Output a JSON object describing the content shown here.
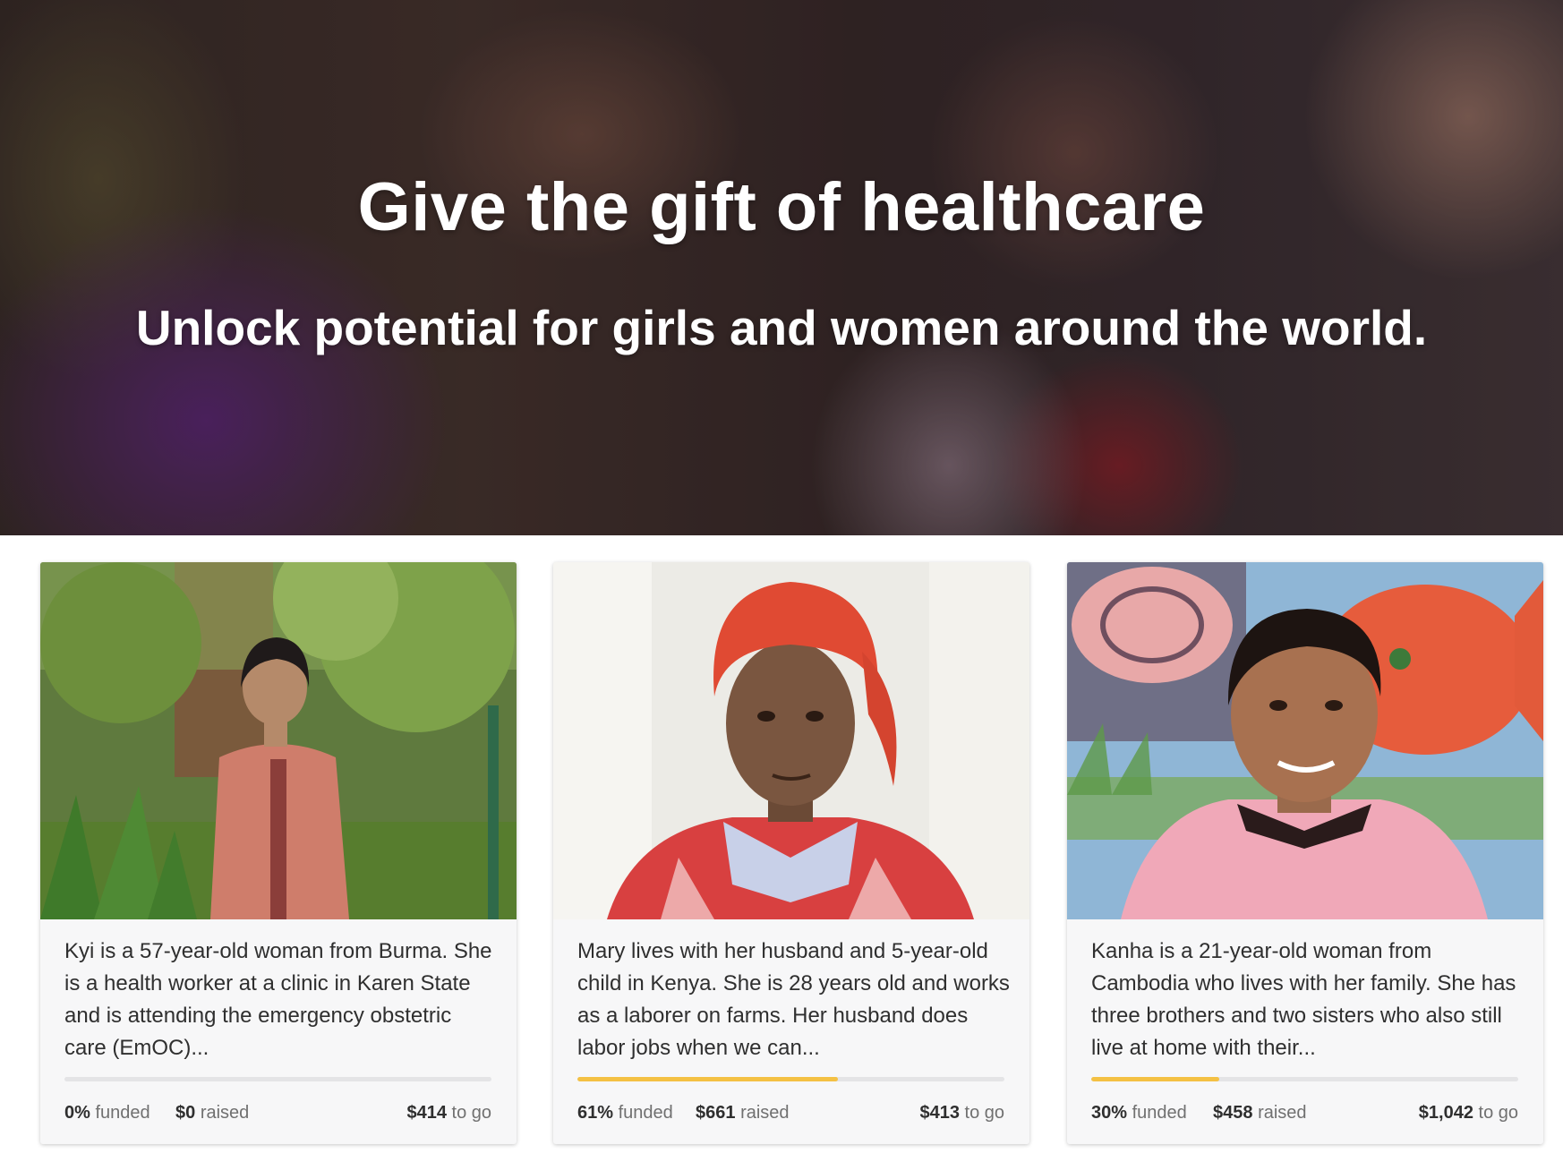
{
  "hero": {
    "title": "Give the gift of healthcare",
    "subtitle": "Unlock potential for girls and women around the world."
  },
  "colors": {
    "progress_fill": "#f4c144",
    "progress_track": "#e4e4e6",
    "card_background": "#f7f7f8"
  },
  "cards": [
    {
      "photo": "portrait of Kyi standing in a garden",
      "description": "Kyi is a 57-year-old woman from Burma. She is a health worker at a clinic in Karen State and is attending the emergency obstetric care (EmOC)...",
      "progress_percent": 0,
      "funded_value": "0%",
      "funded_label": "funded",
      "raised_value": "$0",
      "raised_label": "raised",
      "togo_value": "$414",
      "togo_label": "to go"
    },
    {
      "photo": "portrait of Mary wearing a red head wrap",
      "description": "Mary lives with her husband and 5-year-old child in Kenya. She is 28 years old and works as a laborer on farms. Her husband does labor jobs when we can...",
      "progress_percent": 61,
      "funded_value": "61%",
      "funded_label": "funded",
      "raised_value": "$661",
      "raised_label": "raised",
      "togo_value": "$413",
      "togo_label": "to go"
    },
    {
      "photo": "portrait of Kanha in front of a painted mural",
      "description": "Kanha is a 21-year-old woman from Cambodia who lives with her family. She has three brothers and two sisters who also still live at home with their...",
      "progress_percent": 30,
      "funded_value": "30%",
      "funded_label": "funded",
      "raised_value": "$458",
      "raised_label": "raised",
      "togo_value": "$1,042",
      "togo_label": "to go"
    }
  ]
}
